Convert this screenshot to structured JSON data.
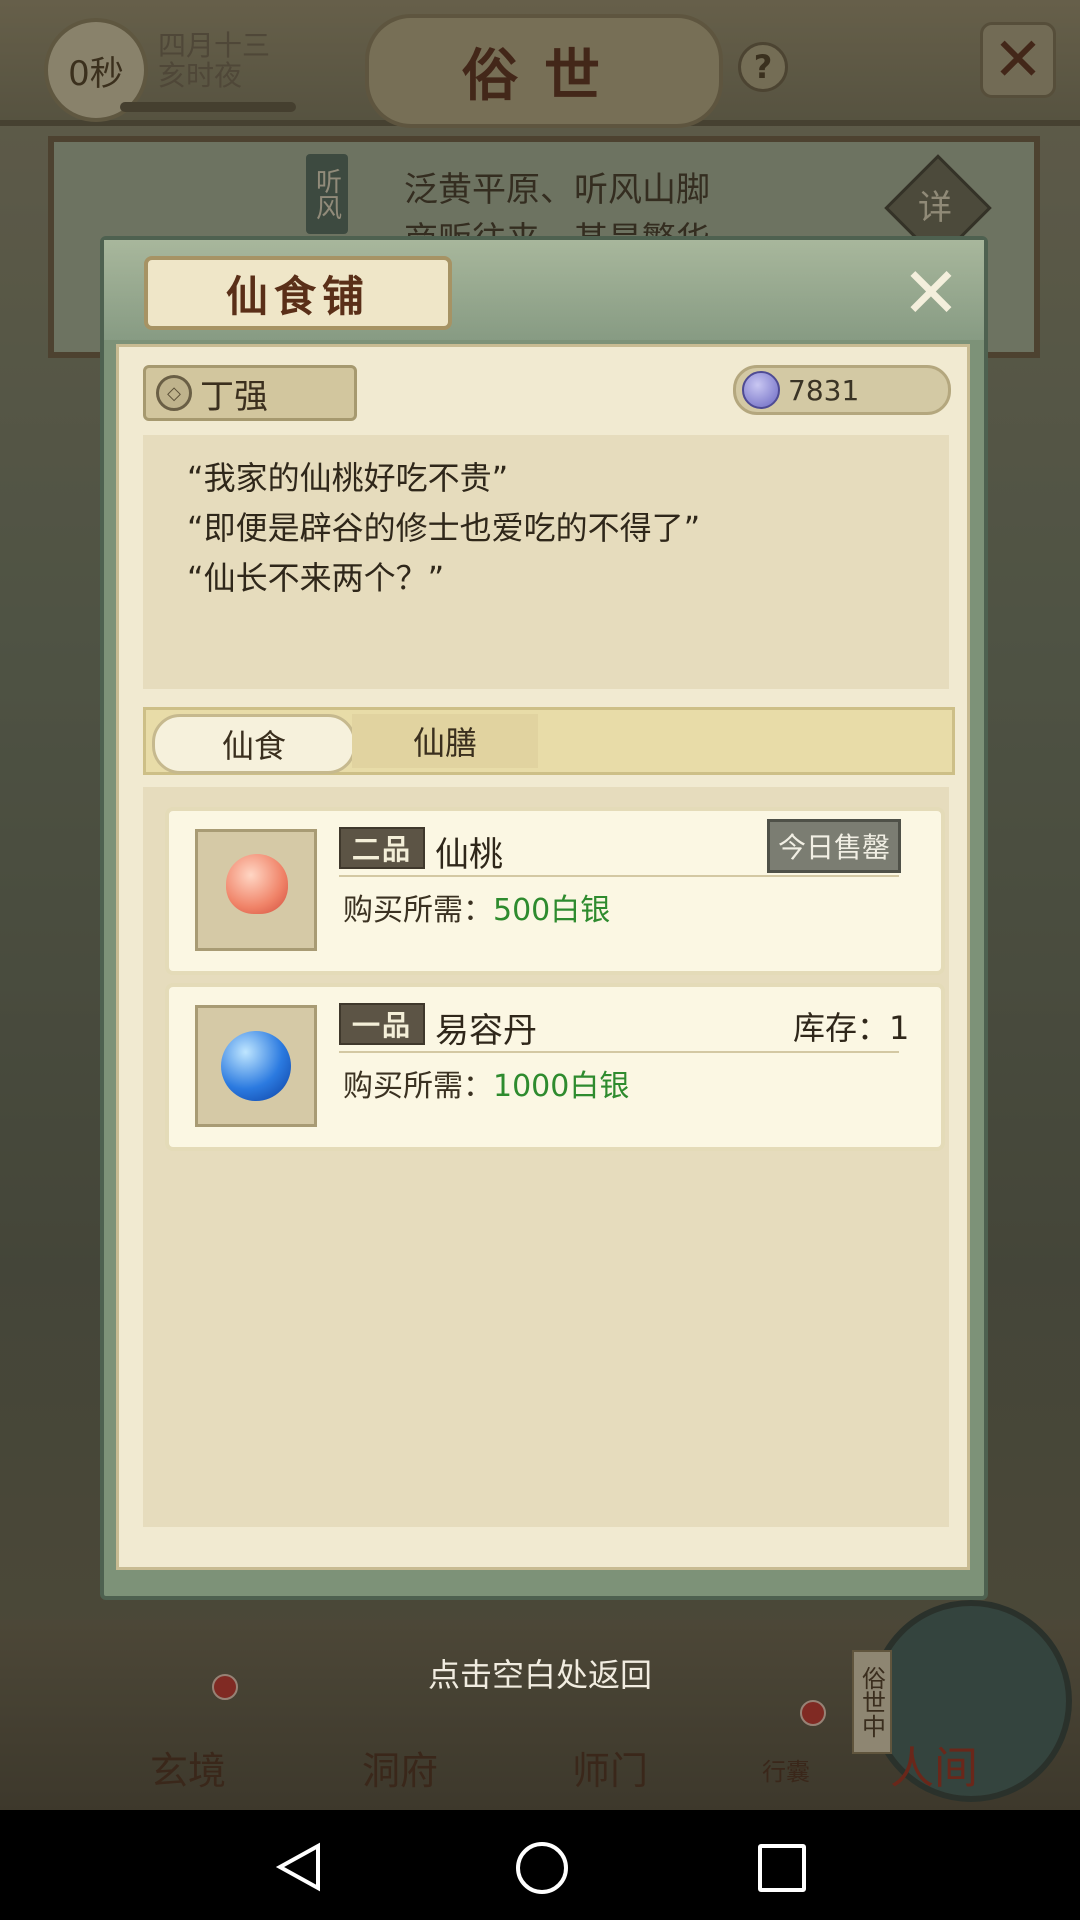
{
  "game": {
    "timer": "0秒",
    "date": "四月十三",
    "time_of_day": "亥时夜",
    "scene_title": "俗世",
    "help_icon": "?",
    "close_icon": "✕"
  },
  "location": {
    "tag": "听风",
    "line1": "泛黄平原、听风山脚",
    "line2": "商贩往来，甚是繁华",
    "detail": "详"
  },
  "shop": {
    "title": "仙食铺",
    "close_icon": "✕",
    "npc_name": "丁强",
    "npc_icon": "◇",
    "currency_amount": "7831",
    "dialogue": [
      "“我家的仙桃好吃不贵”",
      "“即便是辟谷的修士也爱吃的不得了”",
      "“仙长不来两个？”"
    ],
    "tabs": [
      {
        "label": "仙食",
        "active": true
      },
      {
        "label": "仙膳",
        "active": false
      }
    ],
    "items": [
      {
        "grade": "二品",
        "name": "仙桃",
        "price_label": "购买所需：",
        "price_value": "500白银",
        "status": "今日售罄",
        "icon": "peach-icon"
      },
      {
        "grade": "一品",
        "name": "易容丹",
        "price_label": "购买所需：",
        "price_value": "1000白银",
        "stock": "库存：1",
        "icon": "pill-icon"
      }
    ]
  },
  "return_hint": "点击空白处返回",
  "dock": {
    "items": [
      "玄境",
      "洞府",
      "师门",
      "行囊"
    ],
    "world_tag": "俗世中",
    "world_label": "人间"
  },
  "colors": {
    "price_green": "#2e8b2e",
    "modal_green": "#7d9278",
    "title_red": "#5a2a18"
  }
}
